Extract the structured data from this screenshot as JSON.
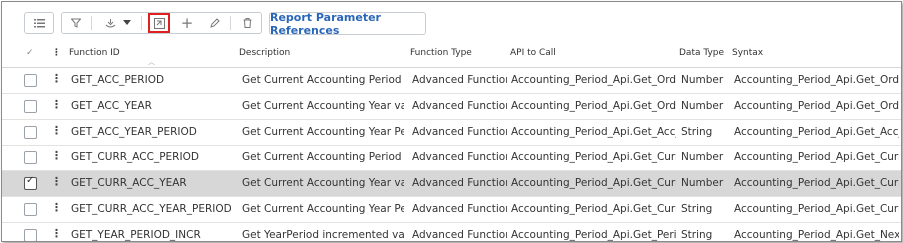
{
  "toolbar": {
    "icons": [
      "list-icon",
      "filter-icon",
      "copy-icon",
      "dropdown-caret-icon",
      "new-window-icon",
      "plus-icon",
      "edit-icon",
      "trash-icon"
    ],
    "report_button_label": "Report Parameter References",
    "highlight_color": "#e02020"
  },
  "columns": {
    "check": "✓",
    "function_id": "Function ID",
    "description": "Description",
    "function_type": "Function Type",
    "api_to_call": "API to Call",
    "data_type": "Data Type",
    "syntax": "Syntax"
  },
  "rows": [
    {
      "function_id": "GET_ACC_PERIOD",
      "description": "Get Current Accounting Period val...",
      "function_type": "Advanced Function",
      "api_to_call": "Accounting_Period_Api.Get_Ordin...",
      "data_type": "Number",
      "syntax": "Accounting_Period_Api.Get_Ordin...",
      "selected": false
    },
    {
      "function_id": "GET_ACC_YEAR",
      "description": "Get Current Accounting Year value...",
      "function_type": "Advanced Function",
      "api_to_call": "Accounting_Period_Api.Get_Ordin...",
      "data_type": "Number",
      "syntax": "Accounting_Period_Api.Get_Ordin...",
      "selected": false
    },
    {
      "function_id": "GET_ACC_YEAR_PERIOD",
      "description": "Get Current Accounting Year Perio...",
      "function_type": "Advanced Function",
      "api_to_call": "Accounting_Period_Api.Get_Acc_Ye...",
      "data_type": "String",
      "syntax": "Accounting_Period_Api.Get_Acc_Ye...",
      "selected": false
    },
    {
      "function_id": "GET_CURR_ACC_PERIOD",
      "description": "Get Current Accounting Period val...",
      "function_type": "Advanced Function",
      "api_to_call": "Accounting_Period_Api.Get_Curr_A...",
      "data_type": "Number",
      "syntax": "Accounting_Period_Api.Get_Curr_A...",
      "selected": false
    },
    {
      "function_id": "GET_CURR_ACC_YEAR",
      "description": "Get Current Accounting Year value...",
      "function_type": "Advanced Function",
      "api_to_call": "Accounting_Period_Api.Get_Curr_A...",
      "data_type": "Number",
      "syntax": "Accounting_Period_Api.Get_Curr_A...",
      "selected": true
    },
    {
      "function_id": "GET_CURR_ACC_YEAR_PERIOD",
      "description": "Get Current Accounting Year Perio...",
      "function_type": "Advanced Function",
      "api_to_call": "Accounting_Period_Api.Get_Curr_A...",
      "data_type": "String",
      "syntax": "Accounting_Period_Api.Get_Curr_A...",
      "selected": false
    },
    {
      "function_id": "GET_YEAR_PERIOD_INCR",
      "description": "Get YearPeriod incremented value...",
      "function_type": "Advanced Function",
      "api_to_call": "Accounting_Period_Api.Get_Period...",
      "data_type": "String",
      "syntax": "Accounting_Period_Api.Get_Next_...",
      "selected": false
    }
  ]
}
